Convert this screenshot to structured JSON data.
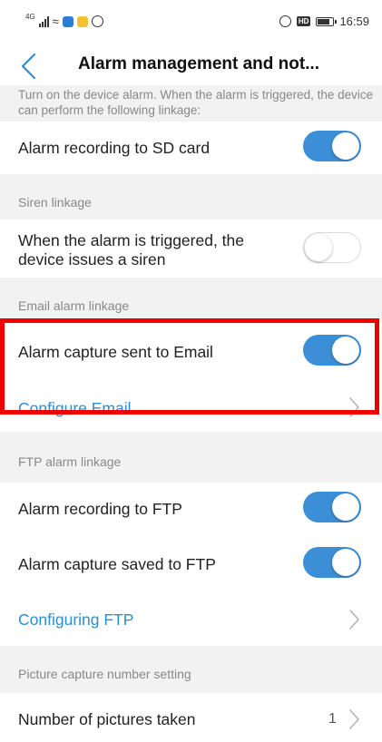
{
  "status_bar": {
    "network_label": "4G",
    "time": "16:59",
    "hd_label": "HD"
  },
  "nav": {
    "back_icon": "chevron-left-icon",
    "title": "Alarm management and not..."
  },
  "description": "Turn on the device alarm. When the alarm is triggered, the device can perform the following linkage:",
  "rows": {
    "sd_recording": {
      "label": "Alarm recording to SD card",
      "enabled": true
    },
    "siren_section": "Siren linkage",
    "siren": {
      "label_line1": "When the alarm is triggered, the",
      "label_line2": "device issues a siren",
      "enabled": false
    },
    "email_section": "Email alarm linkage",
    "email_capture": {
      "label": "Alarm capture sent to Email",
      "enabled": true
    },
    "configure_email": "Configure Email",
    "ftp_section": "FTP alarm linkage",
    "ftp_recording": {
      "label": "Alarm recording to FTP",
      "enabled": true
    },
    "ftp_capture": {
      "label": "Alarm capture saved to FTP",
      "enabled": true
    },
    "configure_ftp": "Configuring FTP",
    "picture_section": "Picture capture number setting",
    "pictures": {
      "label": "Number of pictures taken",
      "value": "1"
    }
  },
  "colors": {
    "accent": "#3c8fd6",
    "link": "#2b8ed6",
    "highlight": "#ee0000",
    "section_bg": "#f2f2f2"
  }
}
